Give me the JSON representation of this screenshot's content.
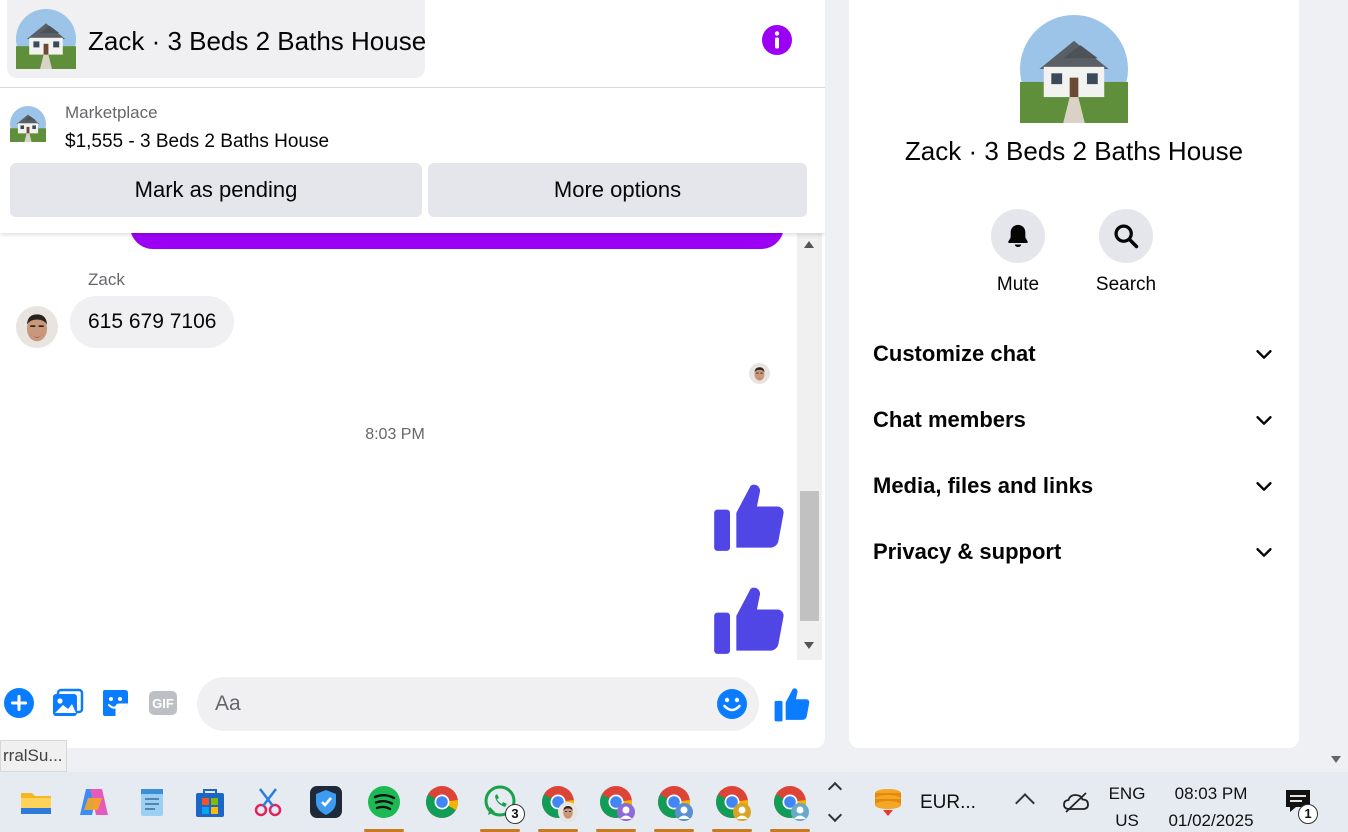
{
  "chat": {
    "title": "Zack · 3 Beds 2 Baths House",
    "marketplace": {
      "label": "Marketplace",
      "listing": "$1,555 - 3 Beds 2 Baths House",
      "primary_button": "Mark as pending",
      "secondary_button": "More options"
    },
    "messages": {
      "sender_name": "Zack",
      "phone_text": "615 679 7106",
      "timestamp": "8:03 PM"
    },
    "composer": {
      "placeholder": "Aa"
    },
    "icons": {
      "info": "info-icon",
      "plus": "plus-circle-icon",
      "image": "image-icon",
      "sticker": "sticker-icon",
      "gif": "gif-icon",
      "emoji": "emoji-icon",
      "like": "thumbs-up-icon"
    }
  },
  "info_panel": {
    "name": "Zack · 3 Beds 2 Baths House",
    "actions": [
      {
        "label": "Mute",
        "icon": "bell-icon"
      },
      {
        "label": "Search",
        "icon": "search-icon"
      }
    ],
    "sections": [
      {
        "label": "Customize chat"
      },
      {
        "label": "Chat members"
      },
      {
        "label": "Media, files and links"
      },
      {
        "label": "Privacy & support"
      }
    ]
  },
  "tooltip": "rralSu...",
  "taskbar": {
    "apps": [
      {
        "name": "file-explorer-icon"
      },
      {
        "name": "copilot-icon"
      },
      {
        "name": "notepad-icon"
      },
      {
        "name": "microsoft-store-icon"
      },
      {
        "name": "snipping-tool-icon"
      },
      {
        "name": "vpn-shield-icon"
      },
      {
        "name": "spotify-icon"
      },
      {
        "name": "chrome-icon"
      },
      {
        "name": "whatsapp-icon",
        "badge": "3"
      },
      {
        "name": "chrome-profile-icon"
      },
      {
        "name": "chrome-profile-icon"
      },
      {
        "name": "chrome-profile-icon"
      },
      {
        "name": "chrome-profile-icon"
      },
      {
        "name": "chrome-profile-icon"
      }
    ],
    "widget_label": "EUR...",
    "language": "ENG",
    "region": "US",
    "time": "08:03 PM",
    "date": "01/02/2025",
    "notification_count": "1"
  },
  "colors": {
    "accent_purple": "#9b00f5",
    "messenger_blue": "#0a7cff",
    "thumb_violet": "#4f46e5",
    "button_gray": "#e4e6eb",
    "bubble_gray": "#f0f0f2"
  }
}
